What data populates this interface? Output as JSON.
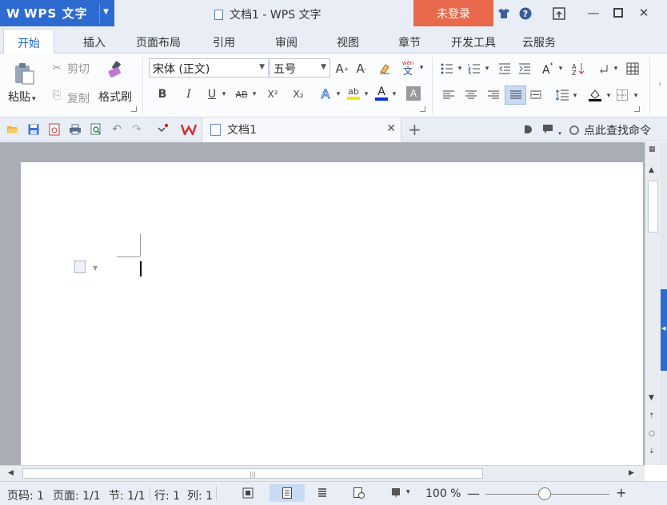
{
  "app": {
    "logo": "W",
    "name": "WPS 文字",
    "doc_title": "文档1 - WPS 文字",
    "login": "未登录"
  },
  "tabs": [
    "开始",
    "插入",
    "页面布局",
    "引用",
    "审阅",
    "视图",
    "章节",
    "开发工具",
    "云服务"
  ],
  "ribbon": {
    "paste": "粘贴",
    "cut": "剪切",
    "copy": "复制",
    "format_painter": "格式刷",
    "font_name": "宋体 (正文)",
    "font_size": "五号",
    "bold": "B",
    "italic": "I",
    "underline": "U",
    "strike": "AB",
    "superscript": "X²",
    "subscript": "X₂",
    "pinyin_top": "wén",
    "pinyin_char": "文",
    "font_color_letter": "A",
    "effects_letter": "A",
    "highlight": "ab",
    "shade_letter": "A"
  },
  "quickbar": {
    "doc_tab": "文档1",
    "search_command": "点此查找命令"
  },
  "statusbar": {
    "page_code": "页码: 1",
    "page": "页面: 1/1",
    "section": "节: 1/1",
    "row": "行: 1",
    "col": "列: 1",
    "zoom": "100 %",
    "zoom_level": 0.48
  },
  "colors": {
    "accent": "#2e6bd1",
    "login_bg": "#e8694b",
    "highlight_yellow": "#f5e600",
    "font_red": "#e01010",
    "font_blue": "#1030e0"
  }
}
